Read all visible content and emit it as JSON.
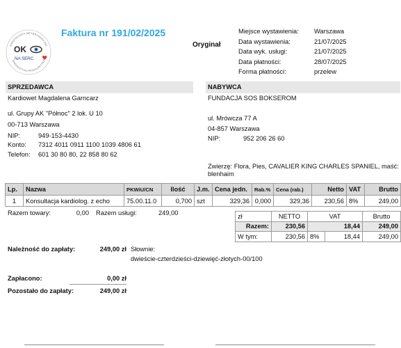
{
  "logo": {
    "main": "OK",
    "sub": "NA SERC",
    "arc_top": "KARDIOLOGIA WETERYNARYJNA",
    "arc_bottom": "DIAGNOSTYKA PROFILAKTYKA"
  },
  "invoice": {
    "title": "Faktura nr 191/02/2025",
    "copy_label": "Oryginał"
  },
  "meta": [
    {
      "label": "Miejsce wystawienia:",
      "value": "Warszawa"
    },
    {
      "label": "Data wystawienia:",
      "value": "21/07/2025"
    },
    {
      "label": "Data wyk. usługi:",
      "value": "21/07/2025"
    },
    {
      "label": "Data płatności:",
      "value": "28/07/2025"
    },
    {
      "label": "Forma płatności:",
      "value": "przelew"
    }
  ],
  "seller": {
    "header": "SPRZEDAWCA",
    "name": "Kardiowet Magdalena Garncarz",
    "street": "ul. Grupy AK \"Północ\" 2 lok. U 10",
    "city": "00-713 Warszawa",
    "nip_label": "NIP:",
    "nip": "949-153-4430",
    "account_label": "Konto:",
    "account": "7312 4011 0911 1100 1039 4806 61",
    "phone_label": "Telefon:",
    "phone": "601 30 80 80, 22 858 80 62"
  },
  "buyer": {
    "header": "NABYWCA",
    "name": "FUNDACJA SOS BOKSEROM",
    "street": "ul. Mrówcza 77 A",
    "city": "04-857 Warszawa",
    "nip_label": "NIP:",
    "nip": "952 206 26 60",
    "animal_line1": "Zwierzę: Flora, Pies, CAVALIER KING CHARLES SPANIEL, maść:",
    "animal_line2": "blenhaim"
  },
  "items": {
    "headers": {
      "lp": "Lp.",
      "name": "Nazwa",
      "pkwiu": "PKWiU/CN",
      "qty": "Ilość",
      "unit": "J.m.",
      "unit_price": "Cena jedn.",
      "discount": "Rab.%",
      "price_after": "Cena (rab.)",
      "net": "Netto",
      "vat": "VAT",
      "gross": "Brutto"
    },
    "rows": [
      {
        "lp": "1",
        "name": "Konsultacja kardiolog. z echo",
        "pkwiu": "75.00.11.0",
        "qty": "0,700",
        "unit": "szt",
        "unit_price": "329,36",
        "discount": "0,000",
        "price_after": "329,36",
        "net": "230,56",
        "vat": "8%",
        "gross": "249,00"
      }
    ]
  },
  "totals_line": {
    "goods_label": "Razem towary:",
    "goods_value": "0,00",
    "services_label": "Razem usługi:",
    "services_value": "249,00"
  },
  "summary": {
    "header": {
      "currency": "zł",
      "net": "NETTO",
      "vat": "VAT",
      "gross": "Brutto"
    },
    "total": {
      "label": "Razem:",
      "net": "230,56",
      "vat": "18,44",
      "gross": "249,00"
    },
    "breakdown": {
      "label": "W tym:",
      "net": "230,56",
      "rate": "8%",
      "vat": "18,44",
      "gross": "249,00"
    }
  },
  "payment": {
    "due_label": "Należność do zapłaty:",
    "due_value": "249,00 zł",
    "words_label": "Słownie:",
    "words_value": "dwieście-czterdzieści-dziewięć-złotych-00/100",
    "paid_label": "Zapłacono:",
    "paid_value": "0,00 zł",
    "remaining_label": "Pozostało do zapłaty:",
    "remaining_value": "249,00 zł"
  },
  "colors": {
    "title": "#2fa8e0",
    "header_bar": "#e7e7e7",
    "logo_blue": "#1f3f8f",
    "logo_heart": "#e0322d"
  }
}
